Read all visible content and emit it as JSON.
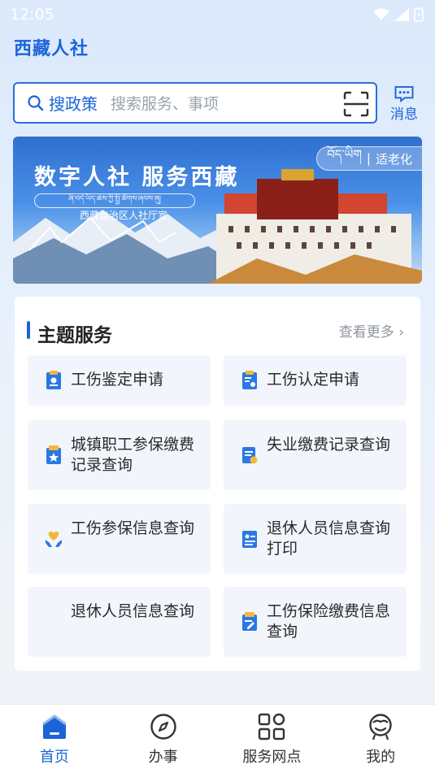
{
  "status_bar": {
    "time": "12:05"
  },
  "header": {
    "title": "西藏人社"
  },
  "search": {
    "label": "搜政策",
    "placeholder": "搜索服务、事项"
  },
  "message": {
    "label": "消息"
  },
  "banner": {
    "title": "数字人社 服务西藏",
    "tibetan_text": "ཞི་བདེ་ཡིད་ཆེས་ཀྱི་སྤྱི་ཚོགས་ཞབས་ཞུ།",
    "department": "西藏自治区人社厅宣",
    "badge_tibetan": "བོད་ཡིག",
    "badge_label": "适老化"
  },
  "services": {
    "title": "主题服务",
    "more": "查看更多",
    "items": [
      {
        "label": "工伤鉴定申请",
        "icon": "clipboard-icon"
      },
      {
        "label": "工伤认定申请",
        "icon": "eye-document-icon"
      },
      {
        "label": "城镇职工参保缴费记录查询",
        "icon": "star-clipboard-icon"
      },
      {
        "label": "失业缴费记录查询",
        "icon": "document-search-icon"
      },
      {
        "label": "工伤参保信息查询",
        "icon": "heart-hands-icon"
      },
      {
        "label": "退休人员信息查询打印",
        "icon": "id-card-icon"
      },
      {
        "label": "退休人员信息查询",
        "icon": ""
      },
      {
        "label": "工伤保险缴费信息查询",
        "icon": "edit-document-icon"
      }
    ]
  },
  "bottom_nav": [
    {
      "label": "首页",
      "icon": "home-icon",
      "active": true
    },
    {
      "label": "办事",
      "icon": "compass-icon",
      "active": false
    },
    {
      "label": "服务网点",
      "icon": "grid-icon",
      "active": false
    },
    {
      "label": "我的",
      "icon": "profile-icon",
      "active": false
    }
  ],
  "colors": {
    "accent": "#1b64d8",
    "tile_bg": "#f2f6fc"
  }
}
